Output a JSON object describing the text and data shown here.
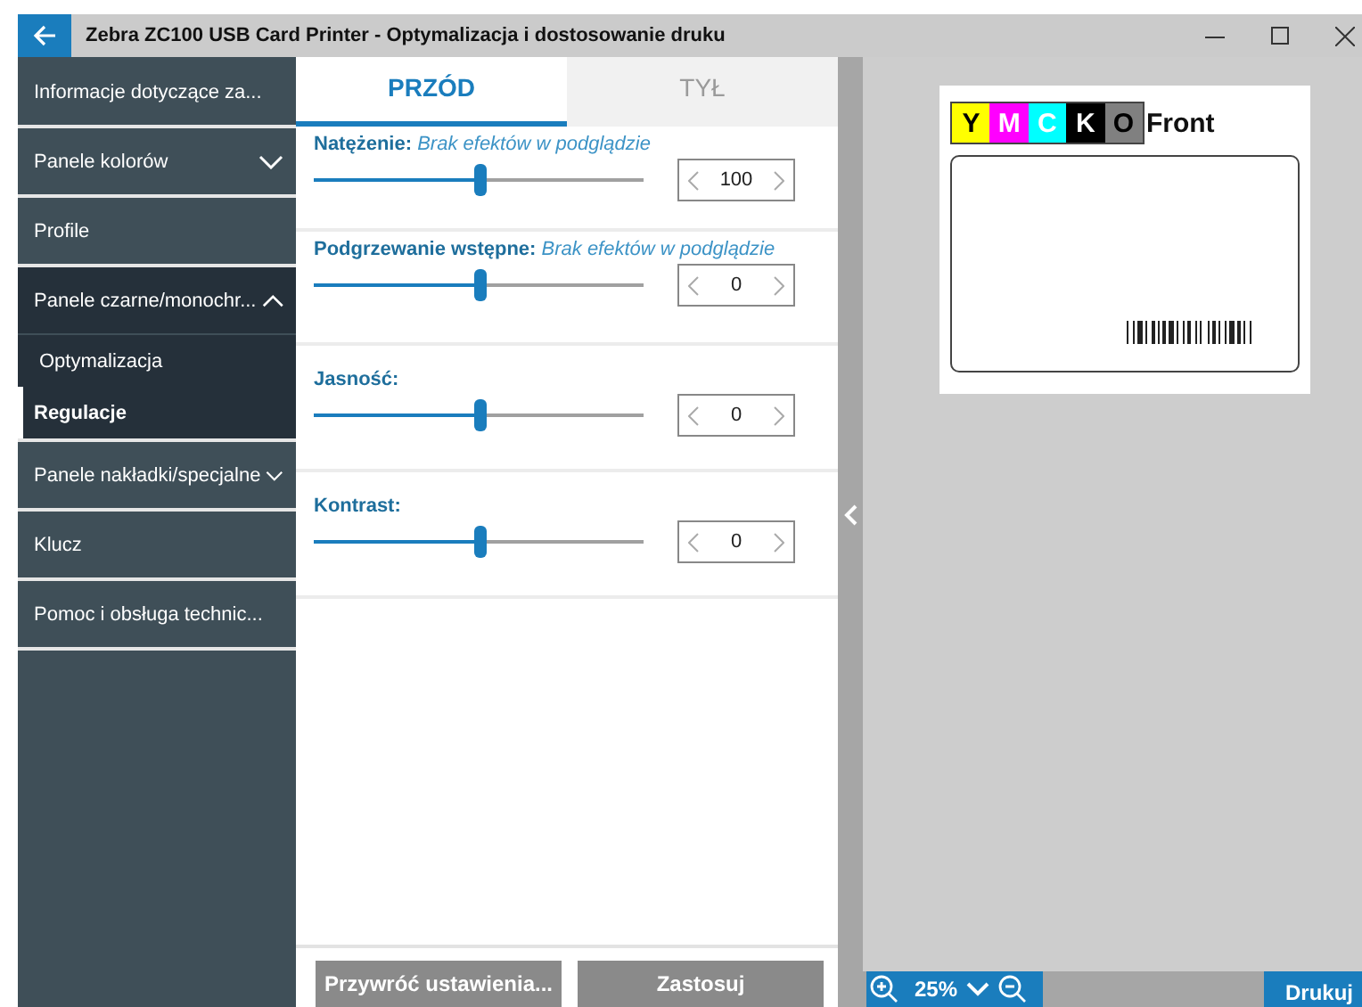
{
  "window": {
    "title": "Zebra ZC100 USB Card Printer - Optymalizacja i dostosowanie druku"
  },
  "sidebar": {
    "items": [
      {
        "label": "Informacje dotyczące za...",
        "selected": false
      },
      {
        "label": "Panele kolorów",
        "selected": false,
        "expanded": false
      },
      {
        "label": "Profile",
        "selected": false
      },
      {
        "label": "Panele czarne/monochr...",
        "selected": false,
        "expanded": true,
        "children": [
          {
            "label": "Optymalizacja",
            "selected": false
          },
          {
            "label": "Regulacje",
            "selected": true
          }
        ]
      },
      {
        "label": "Panele nakładki/specjalne",
        "selected": false,
        "expanded": false
      },
      {
        "label": "Klucz",
        "selected": false
      },
      {
        "label": "Pomoc i obsługa technic...",
        "selected": false
      }
    ]
  },
  "tabs": [
    {
      "label": "PRZÓD",
      "selected": true
    },
    {
      "label": "TYŁ",
      "selected": false
    }
  ],
  "adjustments": [
    {
      "label": "Natężenie:",
      "note": "Brak efektów w podglądzie",
      "level": 0.5,
      "value": "100"
    },
    {
      "label": "Podgrzewanie wstępne:",
      "note": "Brak efektów w podglądzie",
      "level": 0.5,
      "value": "0"
    },
    {
      "label": "Jasność:",
      "level": 0.5,
      "value": "0"
    },
    {
      "label": "Kontrast:",
      "level": 0.5,
      "value": "0"
    }
  ],
  "buttons": [
    "Przywróć ustawienia...",
    "Zastosuj"
  ],
  "preview": {
    "ribbon_panels": [
      {
        "label": "Y",
        "color": "#ffff00"
      },
      {
        "label": "M",
        "color": "#ff00ff"
      },
      {
        "label": "C",
        "color": "#00ffff"
      },
      {
        "label": "K",
        "color": "#000000"
      },
      {
        "label": "O",
        "color": "#808080"
      }
    ],
    "side_label": "Front"
  },
  "zoom": {
    "value": "25%"
  },
  "print_button": "Drukuj"
}
